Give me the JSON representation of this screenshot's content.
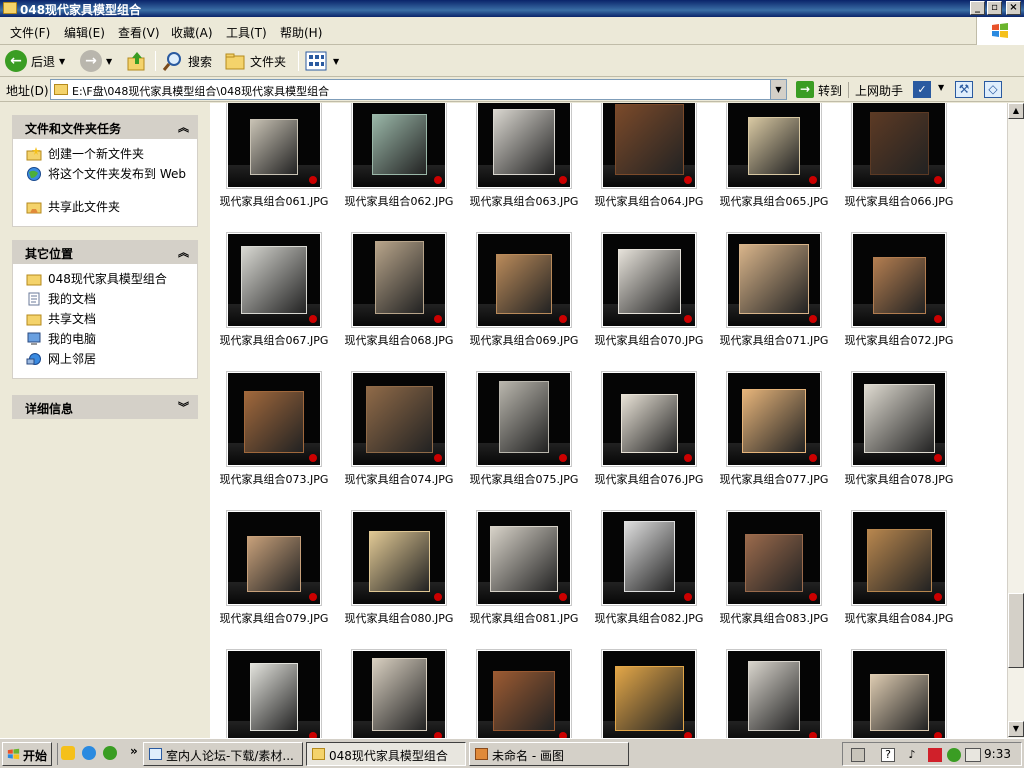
{
  "window": {
    "title": "048现代家具模型组合"
  },
  "menu": [
    "文件(F)",
    "编辑(E)",
    "查看(V)",
    "收藏(A)",
    "工具(T)",
    "帮助(H)"
  ],
  "toolbar": {
    "back": "后退",
    "search": "搜索",
    "folders": "文件夹"
  },
  "address": {
    "label": "地址(D)",
    "path": "E:\\F盘\\048现代家具模型组合\\048现代家具模型组合",
    "go": "转到",
    "assistant": "上网助手"
  },
  "tasks": {
    "title": "文件和文件夹任务",
    "items": [
      "创建一个新文件夹",
      "将这个文件夹发布到 Web",
      "共享此文件夹"
    ]
  },
  "places": {
    "title": "其它位置",
    "items": [
      "048现代家具模型组合",
      "我的文档",
      "共享文档",
      "我的电脑",
      "网上邻居"
    ]
  },
  "details": {
    "title": "详细信息"
  },
  "files": [
    {
      "name": "现代家具组合061.JPG",
      "tone": "#c8c2b4"
    },
    {
      "name": "现代家具组合062.JPG",
      "tone": "#9ab7a8"
    },
    {
      "name": "现代家具组合063.JPG",
      "tone": "#d9d6cf"
    },
    {
      "name": "现代家具组合064.JPG",
      "tone": "#7b4a2a"
    },
    {
      "name": "现代家具组合065.JPG",
      "tone": "#d8c8a2"
    },
    {
      "name": "现代家具组合066.JPG",
      "tone": "#5c3a24"
    },
    {
      "name": "现代家具组合067.JPG",
      "tone": "#d8d8d2"
    },
    {
      "name": "现代家具组合068.JPG",
      "tone": "#b7a48a"
    },
    {
      "name": "现代家具组合069.JPG",
      "tone": "#b98a5a"
    },
    {
      "name": "现代家具组合070.JPG",
      "tone": "#e6e2da"
    },
    {
      "name": "现代家具组合071.JPG",
      "tone": "#d8b48a"
    },
    {
      "name": "现代家具组合072.JPG",
      "tone": "#b27d50"
    },
    {
      "name": "现代家具组合073.JPG",
      "tone": "#a0683c"
    },
    {
      "name": "现代家具组合074.JPG",
      "tone": "#8f6a48"
    },
    {
      "name": "现代家具组合075.JPG",
      "tone": "#b9b6ad"
    },
    {
      "name": "现代家具组合076.JPG",
      "tone": "#e8e2d6"
    },
    {
      "name": "现代家具组合077.JPG",
      "tone": "#e6b47a"
    },
    {
      "name": "现代家具组合078.JPG",
      "tone": "#dedad0"
    },
    {
      "name": "现代家具组合079.JPG",
      "tone": "#c7a07a"
    },
    {
      "name": "现代家具组合080.JPG",
      "tone": "#e0c894"
    },
    {
      "name": "现代家具组合081.JPG",
      "tone": "#d7d2c8"
    },
    {
      "name": "现代家具组合082.JPG",
      "tone": "#dedede"
    },
    {
      "name": "现代家具组合083.JPG",
      "tone": "#9a6a4c"
    },
    {
      "name": "现代家具组合084.JPG",
      "tone": "#b7864e"
    },
    {
      "name": "",
      "tone": "#e2e2dc"
    },
    {
      "name": "",
      "tone": "#d8cfc0"
    },
    {
      "name": "",
      "tone": "#9a5a32"
    },
    {
      "name": "",
      "tone": "#e2a648"
    },
    {
      "name": "",
      "tone": "#d8d4cc"
    },
    {
      "name": "",
      "tone": "#dccab0"
    }
  ],
  "taskbar": {
    "start": "开始",
    "buttons": [
      "室内人论坛-下载/素材...",
      "048现代家具模型组合",
      "未命名 - 画图"
    ],
    "clock": "9:33"
  },
  "colors": {
    "titlebar": "#0a246a",
    "selection": "#316ac5"
  }
}
